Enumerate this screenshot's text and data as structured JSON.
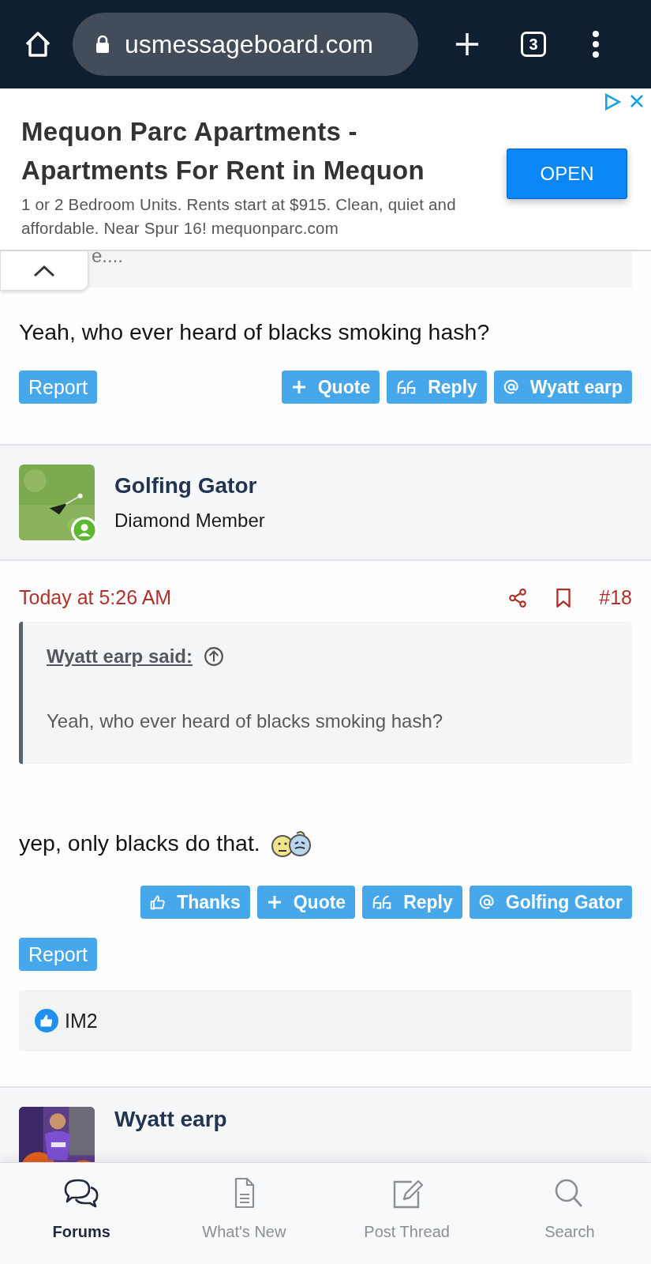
{
  "browser": {
    "url": "usmessageboard.com",
    "tab_count": "3"
  },
  "ad": {
    "title": "Mequon Parc Apartments - Apartments For Rent in Mequon",
    "description": "1 or 2 Bedroom Units. Rents start at $915. Clean, quiet and affordable. Near Spur 16! mequonparc.com",
    "button": "OPEN"
  },
  "posts": [
    {
      "kind": "partial",
      "quote_tail": "e....",
      "body": "Yeah, who ever heard of blacks smoking hash?",
      "report": "Report",
      "actions": [
        {
          "kind": "quote",
          "label": "Quote"
        },
        {
          "kind": "reply",
          "label": "Reply"
        },
        {
          "kind": "mention",
          "label": "Wyatt earp"
        }
      ]
    },
    {
      "kind": "full",
      "author": "Golfing Gator",
      "role": "Diamond Member",
      "online": true,
      "time": "Today at 5:26 AM",
      "number": "#18",
      "quote": {
        "author": "Wyatt earp said:",
        "text": "Yeah, who ever heard of blacks smoking hash?"
      },
      "body": "yep, only blacks do that.",
      "actions": [
        {
          "kind": "thanks",
          "label": "Thanks"
        },
        {
          "kind": "quote",
          "label": "Quote"
        },
        {
          "kind": "reply",
          "label": "Reply"
        },
        {
          "kind": "mention",
          "label": "Golfing Gator"
        }
      ],
      "report": "Report",
      "reactions": [
        {
          "name": "IM2"
        }
      ]
    },
    {
      "kind": "header",
      "author": "Wyatt earp"
    }
  ],
  "nav": [
    {
      "kind": "forums",
      "label": "Forums",
      "selected": true
    },
    {
      "kind": "new",
      "label": "What's New",
      "selected": false
    },
    {
      "kind": "post",
      "label": "Post Thread",
      "selected": false
    },
    {
      "kind": "search",
      "label": "Search",
      "selected": false
    }
  ]
}
